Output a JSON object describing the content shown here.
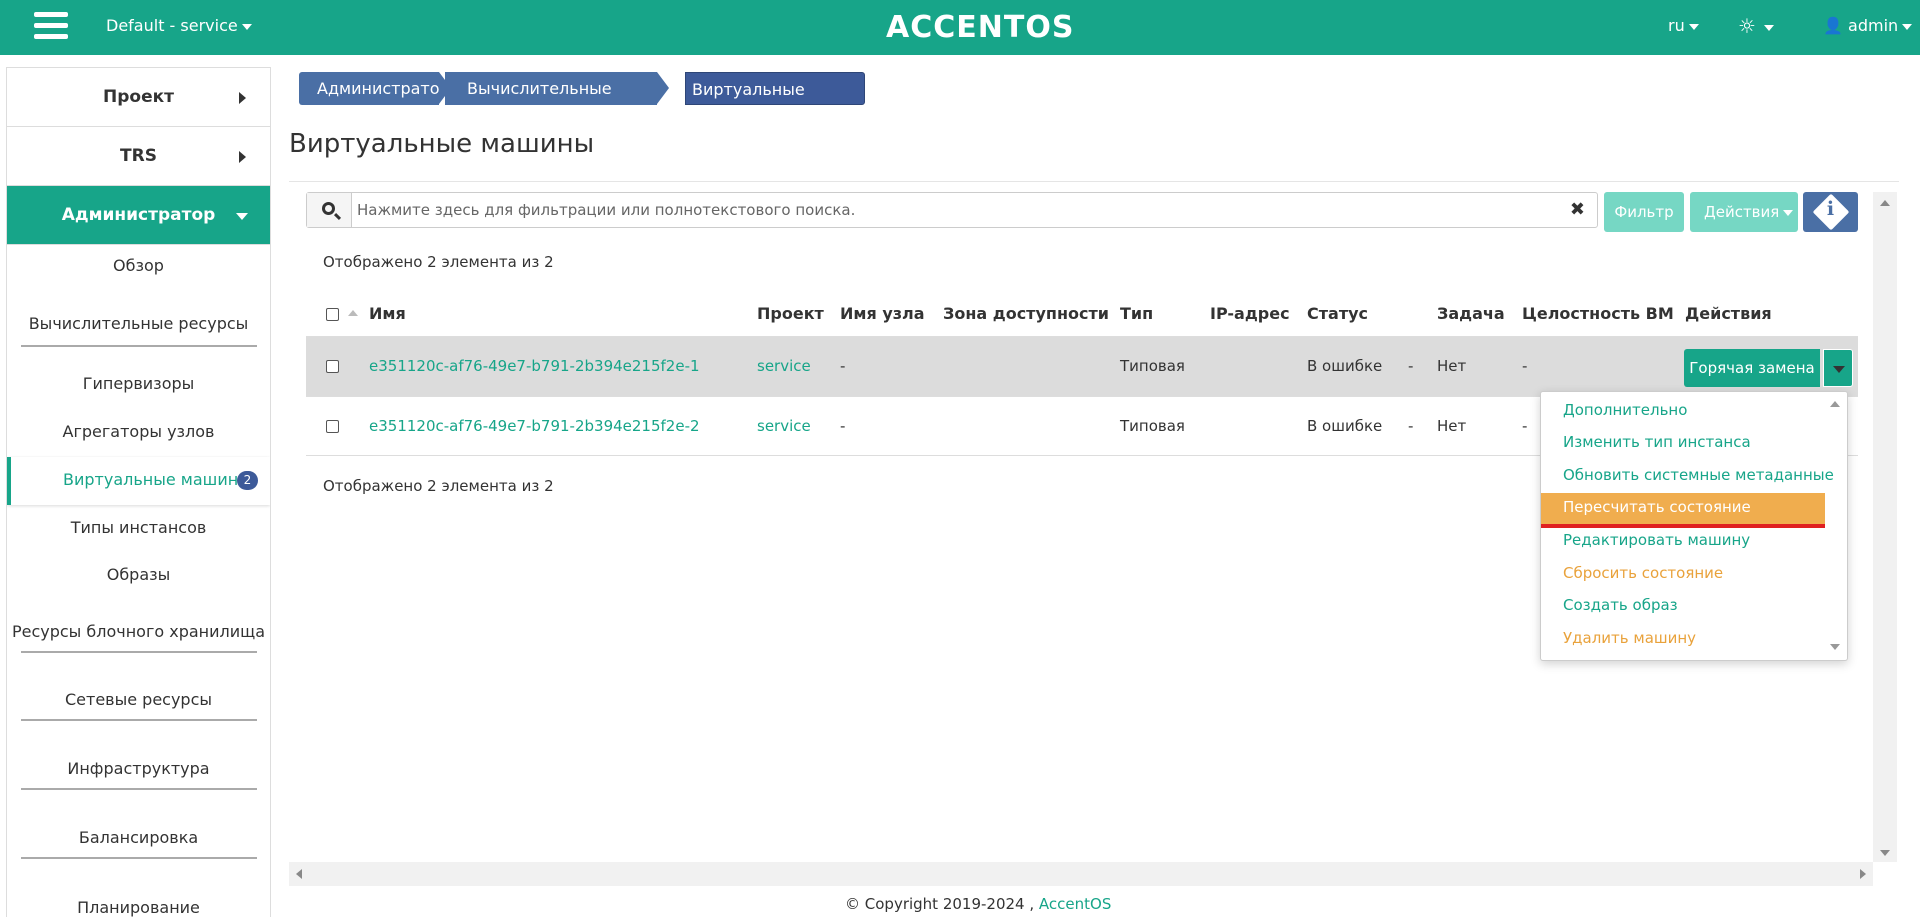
{
  "header": {
    "project_switch": "Default - service",
    "brand": "ACCENTOS",
    "language": "ru",
    "theme_icon": "sun-icon",
    "user": "admin"
  },
  "sidebar": {
    "sections": {
      "project": "Проект",
      "trs": "TRS",
      "admin": "Администратор"
    },
    "items": {
      "overview": "Обзор",
      "compute": "Вычислительные ресурсы",
      "hypervisors": "Гипервизоры",
      "aggregates": "Агрегаторы узлов",
      "vms": "Виртуальные машины",
      "vms_badge": "2",
      "flavors": "Типы инстансов",
      "images": "Образы",
      "block_storage": "Ресурсы блочного хранилища",
      "network": "Сетевые ресурсы",
      "infrastructure": "Инфраструктура",
      "balancing": "Балансировка",
      "planning": "Планирование"
    }
  },
  "breadcrumb": [
    "Администратор",
    "Вычислительные ресурсы",
    "Виртуальные машины"
  ],
  "page_title": "Виртуальные машины",
  "search": {
    "placeholder": "Нажмите здесь для фильтрации или полнотекстового поиска.",
    "value": ""
  },
  "toolbar": {
    "filter_label": "Фильтр",
    "actions_label": "Действия"
  },
  "count_text": "Отображено 2 элемента из 2",
  "table": {
    "columns": [
      "Имя",
      "Проект",
      "Имя узла",
      "Зона доступности",
      "Тип",
      "IP-адрес",
      "Статус",
      "Задача",
      "Целостность ВМ",
      "Действия"
    ],
    "rows": [
      {
        "name": "e351120c-af76-49e7-b791-2b394e215f2e-1",
        "project": "service",
        "host": "-",
        "zone": "",
        "type": "Типовая",
        "ip": "",
        "status": "В ошибке",
        "status_extra": "-",
        "task": "Нет",
        "integrity": "-",
        "action": "Горячая замена"
      },
      {
        "name": "e351120c-af76-49e7-b791-2b394e215f2e-2",
        "project": "service",
        "host": "-",
        "zone": "",
        "type": "Типовая",
        "ip": "",
        "status": "В ошибке",
        "status_extra": "-",
        "task": "Нет",
        "integrity": "-",
        "action": ""
      }
    ]
  },
  "dropdown": {
    "items": [
      {
        "label": "Дополнительно",
        "color": "green"
      },
      {
        "label": "Изменить тип инстанса",
        "color": "green"
      },
      {
        "label": "Обновить системные метаданные",
        "color": "green"
      },
      {
        "label": "Пересчитать состояние",
        "color": "highlight"
      },
      {
        "label": "Редактировать машину",
        "color": "green"
      },
      {
        "label": "Сбросить состояние",
        "color": "orange"
      },
      {
        "label": "Создать образ",
        "color": "green"
      },
      {
        "label": "Удалить машину",
        "color": "orange"
      }
    ]
  },
  "footer": {
    "copyright": "© Copyright 2019-2024 ,",
    "link": "AccentOS"
  },
  "colors": {
    "accent": "#17a589",
    "breadcrumb": "#4a6fa5",
    "highlight": "#f0ad4e",
    "warning_text": "#e9a23b"
  }
}
